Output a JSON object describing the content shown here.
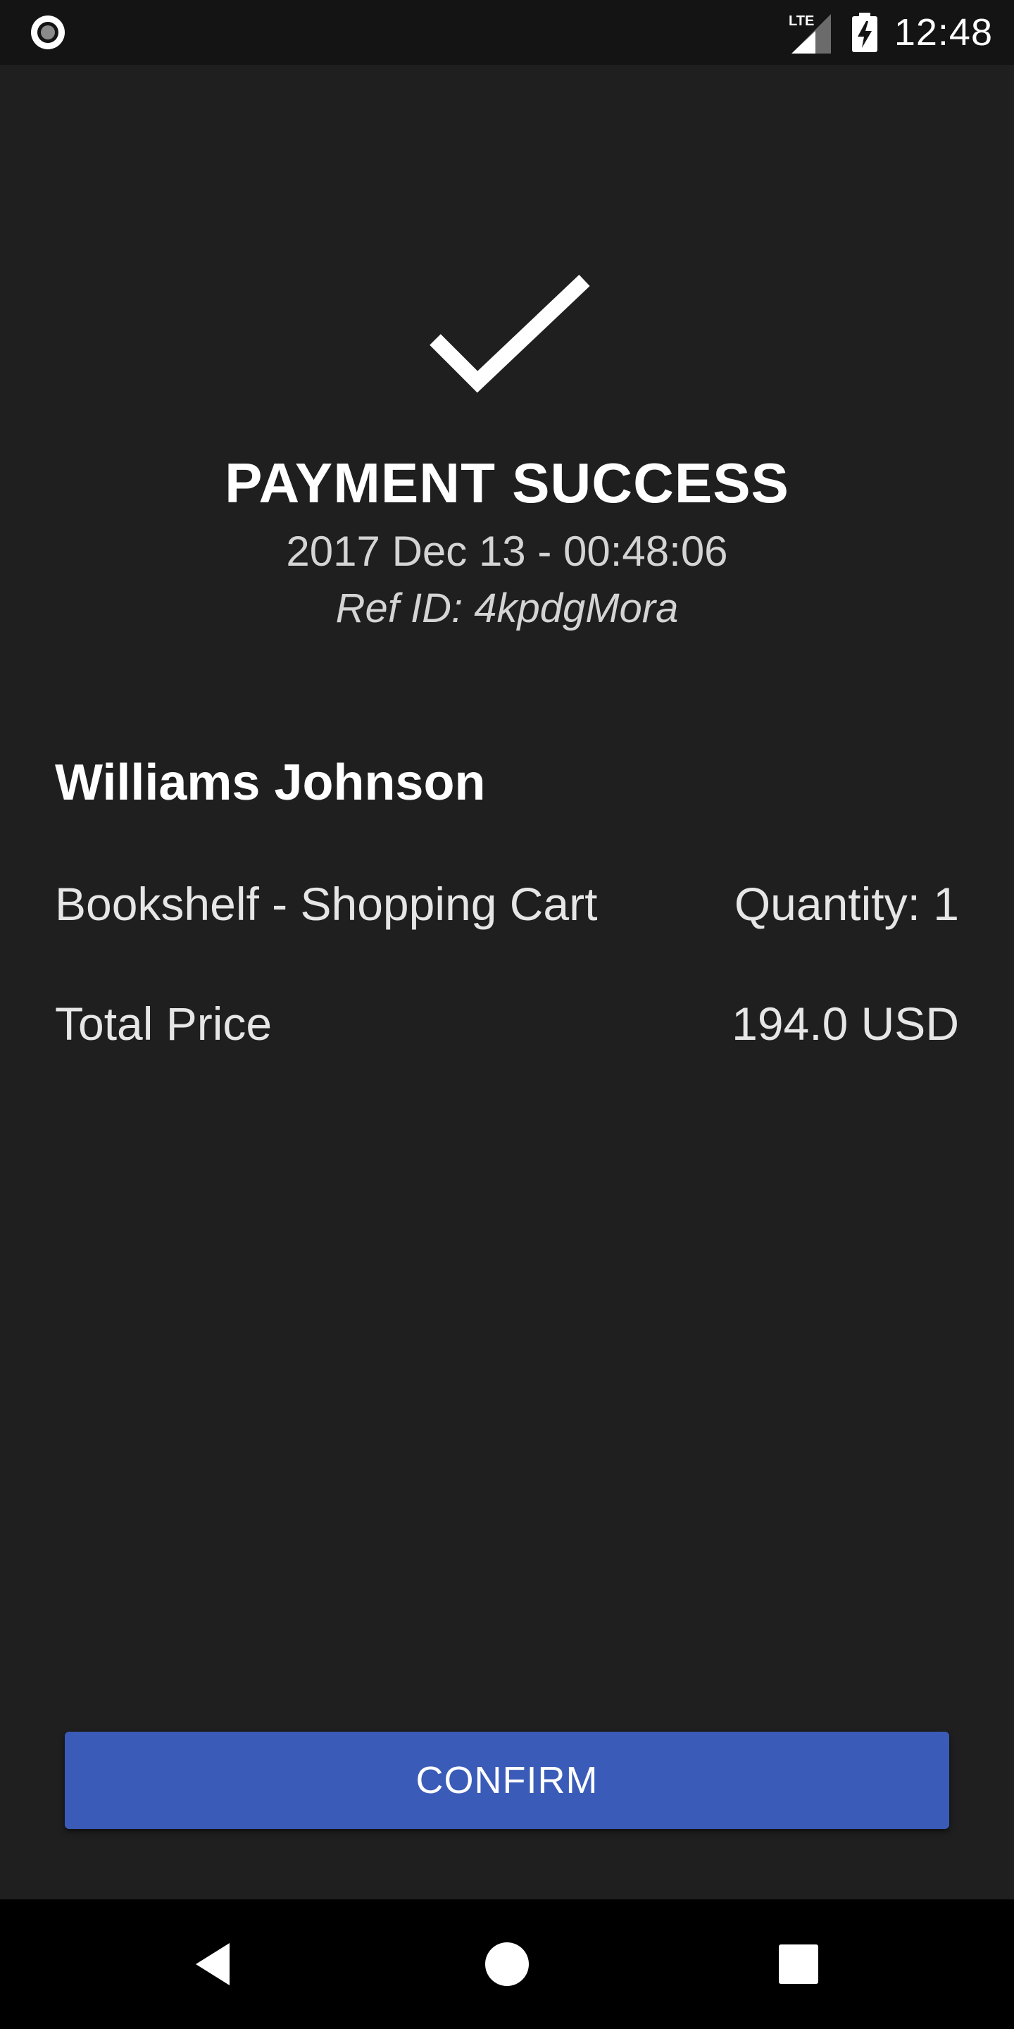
{
  "status_bar": {
    "time": "12:48",
    "network_label": "LTE",
    "icons": [
      "record-icon",
      "signal-icon",
      "battery-charging-icon"
    ]
  },
  "payment": {
    "title": "PAYMENT SUCCESS",
    "datetime": "2017 Dec 13 - 00:48:06",
    "ref_id": "Ref ID: 4kpdgMora",
    "success_icon": "checkmark-icon"
  },
  "order": {
    "customer_name": "Williams Johnson",
    "item_label": "Bookshelf - Shopping Cart",
    "quantity_label": "Quantity: 1",
    "total_label": "Total Price",
    "total_value": "194.0 USD"
  },
  "actions": {
    "confirm_label": "CONFIRM",
    "confirm_color": "#3a5bb8"
  },
  "nav_bar": {
    "icons": [
      "back-icon",
      "home-icon",
      "recents-icon"
    ]
  },
  "colors": {
    "background": "#1f1f1f",
    "status_bar": "#141414",
    "nav_bar": "#000000",
    "text_primary": "#ffffff",
    "text_secondary": "#d4d4d4"
  }
}
